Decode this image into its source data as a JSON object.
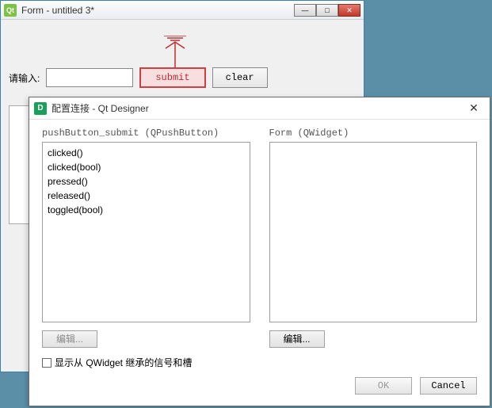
{
  "form": {
    "title": "Form - untitled 3*",
    "input_label": "请输入:",
    "input_value": "",
    "submit_label": "submit",
    "clear_label": "clear"
  },
  "dialog": {
    "title": "配置连接 - Qt Designer",
    "left_panel_label": "pushButton_submit (QPushButton)",
    "right_panel_label": "Form (QWidget)",
    "signals": [
      "clicked()",
      "clicked(bool)",
      "pressed()",
      "released()",
      "toggled(bool)"
    ],
    "slots": [],
    "edit_left_label": "编辑...",
    "edit_right_label": "编辑...",
    "checkbox_label": "显示从 QWidget 继承的信号和槽",
    "ok_label": "OK",
    "cancel_label": "Cancel"
  },
  "colors": {
    "submit_border": "#d04040",
    "qt_green": "#7ec242",
    "d_green": "#1aa05a"
  }
}
